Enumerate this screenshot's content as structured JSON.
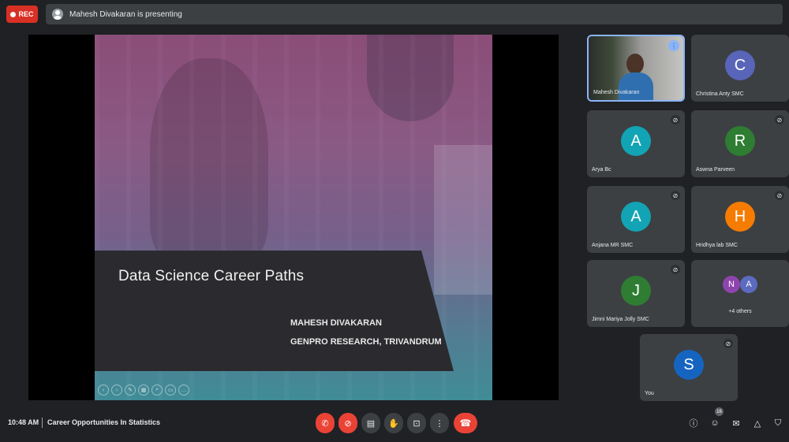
{
  "top_bar": {
    "rec_label": "REC",
    "presenting_text": "Mahesh Divakaran is presenting"
  },
  "slide": {
    "title": "Data Science Career Paths",
    "author": "MAHESH DIVAKARAN",
    "affiliation": "GENPRO RESEARCH, TRIVANDRUM"
  },
  "participants": [
    {
      "name": "Mahesh Divakaran",
      "type": "video"
    },
    {
      "name": "Christina Anty SMC",
      "initial": "C",
      "color": "#5865b8"
    },
    {
      "name": "Arya Bc",
      "initial": "A",
      "color": "#12a4b4"
    },
    {
      "name": "Aswna Parveen",
      "initial": "R",
      "color": "#2e7d32"
    },
    {
      "name": "Anjana MR SMC",
      "initial": "A",
      "color": "#12a4b4"
    },
    {
      "name": "Hridhya lab SMC",
      "initial": "H",
      "color": "#f57c00"
    },
    {
      "name": "Jimni Mariya Jolly SMC",
      "initial": "J",
      "color": "#2e7d32"
    },
    {
      "name": "You",
      "initial": "S",
      "color": "#1565c0"
    }
  ],
  "others_tile": {
    "label": "+4 others",
    "avatars": [
      {
        "initial": "N",
        "color": "#8e44ad"
      },
      {
        "initial": "A",
        "color": "#5c6bc0"
      }
    ]
  },
  "bottom_bar": {
    "time": "10:48 AM",
    "meeting_title": "Career Opportunities In Statistics",
    "people_count": "16"
  },
  "colors": {
    "background": "#202124",
    "tile": "#3c4043",
    "danger": "#ea4335",
    "active_border": "#8ab4f8"
  }
}
